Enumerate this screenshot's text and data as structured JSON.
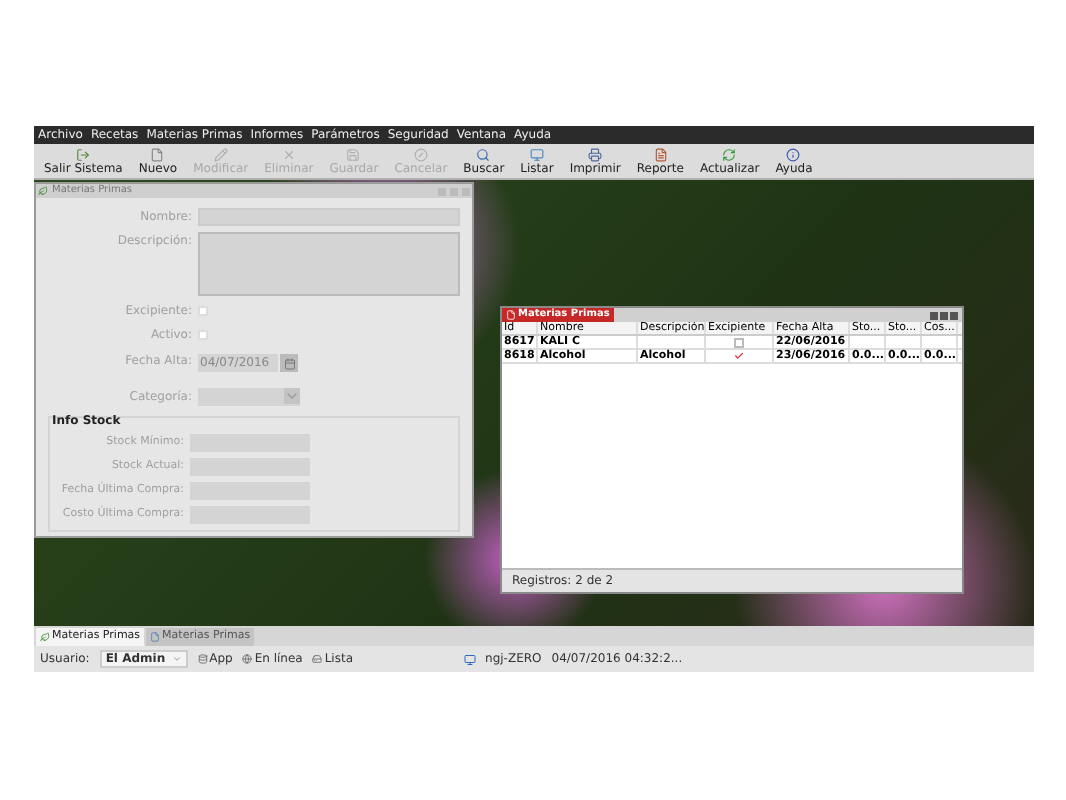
{
  "menu": [
    "Archivo",
    "Recetas",
    "Materias Primas",
    "Informes",
    "Parámetros",
    "Seguridad",
    "Ventana",
    "Ayuda"
  ],
  "toolbar": [
    {
      "label": "Salir Sistema",
      "kind": "exit",
      "disabled": false
    },
    {
      "label": "Nuevo",
      "kind": "new",
      "disabled": false
    },
    {
      "label": "Modificar",
      "kind": "edit",
      "disabled": true
    },
    {
      "label": "Eliminar",
      "kind": "delete",
      "disabled": true
    },
    {
      "label": "Guardar",
      "kind": "save",
      "disabled": true
    },
    {
      "label": "Cancelar",
      "kind": "cancel",
      "disabled": true
    },
    {
      "label": "Buscar",
      "kind": "search",
      "disabled": false
    },
    {
      "label": "Listar",
      "kind": "list",
      "disabled": false
    },
    {
      "label": "Imprimir",
      "kind": "print",
      "disabled": false
    },
    {
      "label": "Reporte",
      "kind": "report",
      "disabled": false
    },
    {
      "label": "Actualizar",
      "kind": "refresh",
      "disabled": false
    },
    {
      "label": "Ayuda",
      "kind": "help",
      "disabled": false
    }
  ],
  "form_window": {
    "title": "Materias Primas",
    "disabled": true,
    "fields": [
      {
        "kind": "text",
        "label": "Nombre:"
      },
      {
        "kind": "textarea",
        "label": "Descripción:"
      },
      {
        "kind": "checkbox",
        "label": "Excipiente:",
        "checked": false
      },
      {
        "kind": "checkbox",
        "label": "Activo:",
        "checked": false
      },
      {
        "kind": "date",
        "label": "Fecha Alta:",
        "value": "04/07/2016"
      },
      {
        "kind": "select",
        "label": "Categoría:"
      }
    ],
    "stock_section": {
      "title": "Info Stock",
      "fields": [
        "Stock Mínimo:",
        "Stock Actual:",
        "Fecha Última Compra:",
        "Costo Última Compra:"
      ]
    }
  },
  "list_window": {
    "title": "Materias Primas",
    "columns": [
      "Id",
      "Nombre",
      "Descripción",
      "Excipiente",
      "Fecha Alta",
      "Sto...",
      "Sto...",
      "Cos..."
    ],
    "rows": [
      {
        "cells": [
          "8617",
          "KALI C",
          "",
          null,
          "22/06/2016",
          "",
          "",
          ""
        ],
        "excipiente": false
      },
      {
        "cells": [
          "8618",
          "Alcohol",
          "Alcohol",
          null,
          "23/06/2016",
          "0.0...",
          "0.0...",
          "0.0..."
        ],
        "excipiente": true
      }
    ],
    "footer": "Registros: 2 de 2"
  },
  "tabs": [
    {
      "label": "Materias Primas",
      "selected": true
    },
    {
      "label": "Materias Primas",
      "selected": false
    }
  ],
  "status": {
    "user_label": "Usuario:",
    "user": "El Admin",
    "items": [
      {
        "kind": "app",
        "label": "App"
      },
      {
        "kind": "online",
        "label": "En línea"
      },
      {
        "kind": "ready",
        "label": "Lista"
      }
    ],
    "host": "ngj-ZERO",
    "datetime": "04/07/2016 04:32:2..."
  }
}
